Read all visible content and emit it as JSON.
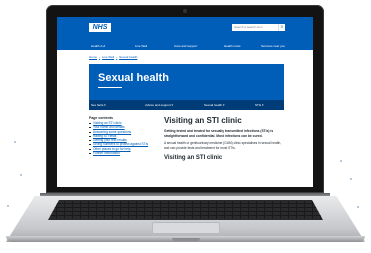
{
  "header": {
    "logo": "NHS",
    "search_placeholder": "Search a search term",
    "nav": [
      "Health A-Z",
      "Live Well",
      "Care and support",
      "Health news",
      "Services near you"
    ]
  },
  "breadcrumb": [
    "Home",
    "Live Well",
    "Sexual health"
  ],
  "hero": {
    "title": "Sexual health"
  },
  "tabs": [
    "Sex facts ▾",
    "Advice and support ▾",
    "Sexual health ▾",
    "STIs ▾"
  ],
  "contents": {
    "title": "Page contents",
    "items": [
      "Visiting an STI clinic",
      "Your name and details",
      "Answering some questions",
      "Having STI tests",
      "Getting your test results",
      "Giving numbers to protect against STIs",
      "Other places to go for help",
      "Further information"
    ]
  },
  "article": {
    "title": "Visiting an STI clinic",
    "lead": "Getting tested and treated for sexually transmitted infections (STIs) is straightforward and confidential. Most infections can be cured.",
    "paragraph": "A sexual health or genitourinary medicine (GUM) clinic specialises in sexual health, and can provide tests and treatment for most STIs.",
    "subtitle": "Visiting an STI clinic"
  },
  "colors": {
    "nhs_blue": "#005eb8",
    "nhs_dark_blue": "#003d78",
    "text": "#212b32"
  }
}
